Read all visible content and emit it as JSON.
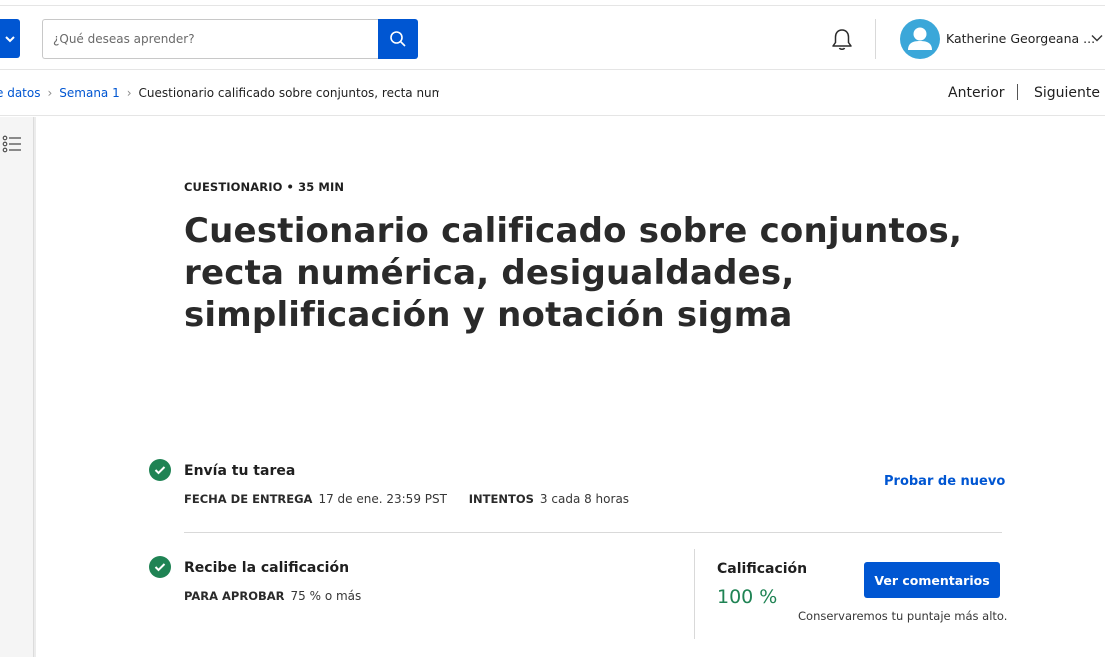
{
  "header": {
    "search": {
      "placeholder": "¿Qué deseas aprender?",
      "value": ""
    },
    "user": {
      "name": "Katherine Georgeana ..."
    }
  },
  "breadcrumb": {
    "items": [
      "e datos",
      "Semana 1"
    ],
    "current": "Cuestionario calificado sobre conjuntos, recta numéri"
  },
  "nav": {
    "prev": "Anterior",
    "next": "Siguiente"
  },
  "assignment": {
    "eyebrow": "CUESTIONARIO • 35 MIN",
    "title": "Cuestionario calificado sobre conjuntos, recta numérica, desigualdades, simplificación y notación sigma",
    "submit": {
      "title": "Envía tu tarea",
      "due_label": "FECHA DE ENTREGA",
      "due_value": "17 de ene. 23:59 PST",
      "attempts_label": "INTENTOS",
      "attempts_value": "3 cada 8 horas",
      "retry": "Probar de nuevo"
    },
    "grade": {
      "title": "Recibe la calificación",
      "pass_label": "PARA APROBAR",
      "pass_value": "75 % o más",
      "grade_label": "Calificación",
      "grade_value": "100 %",
      "feedback_button": "Ver comentarios",
      "note": "Conservaremos tu puntaje más alto."
    }
  },
  "colors": {
    "brand": "#0056d2",
    "success": "#1f8354",
    "avatar": "#3ba7d9"
  },
  "icons": [
    "chevron-down-icon",
    "search-icon",
    "bell-icon",
    "user-avatar-icon",
    "list-icon",
    "check-icon"
  ]
}
